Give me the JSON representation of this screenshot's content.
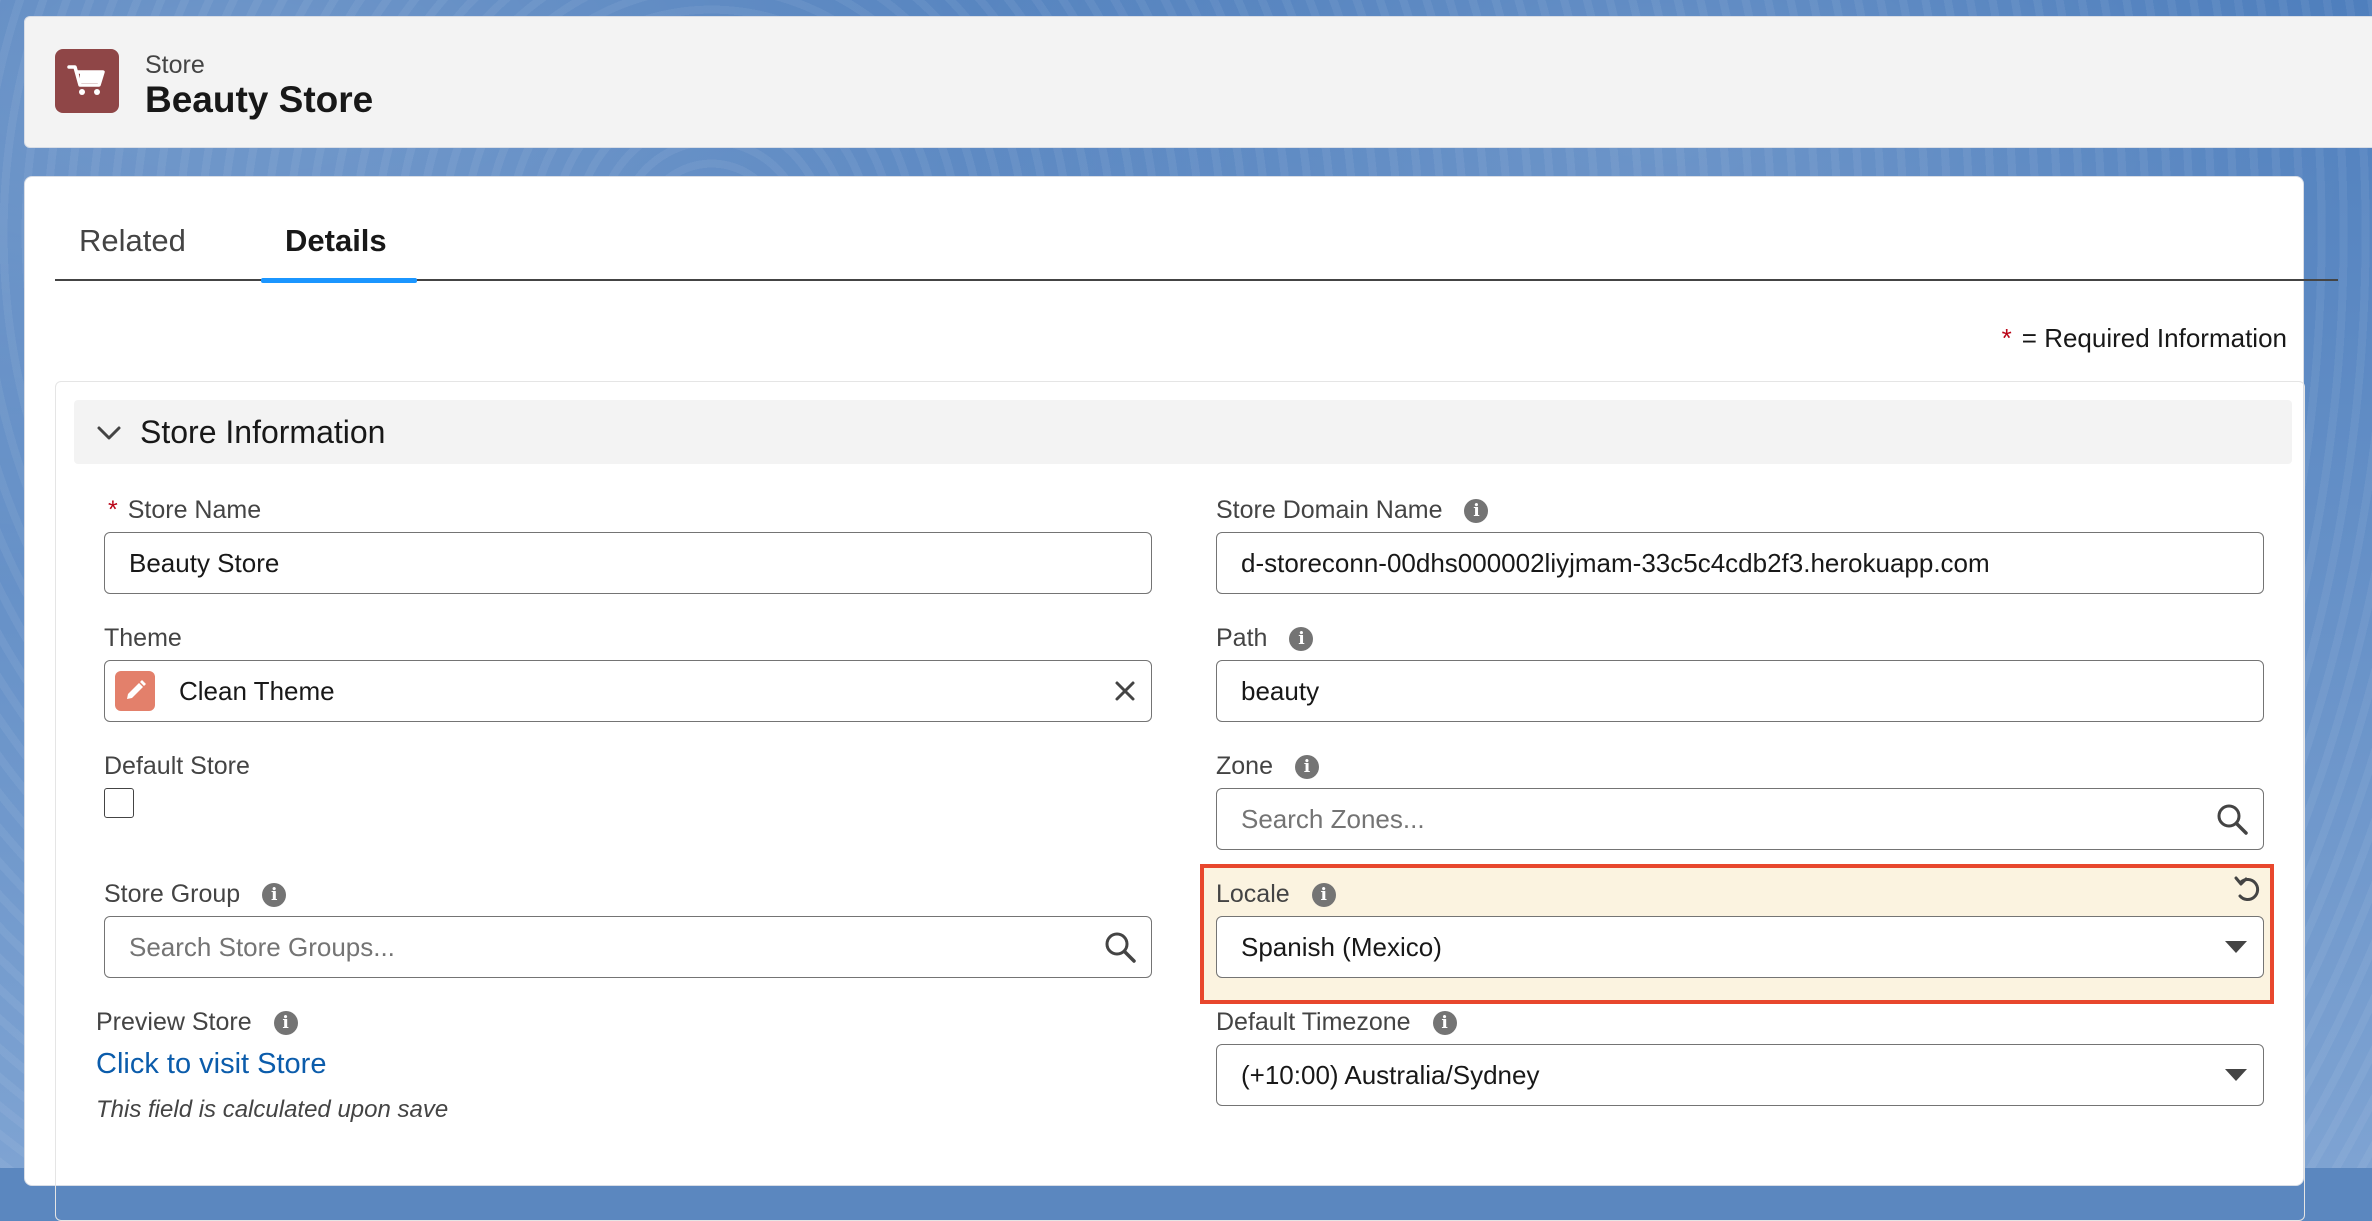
{
  "header": {
    "object_label": "Store",
    "record_title": "Beauty Store",
    "icon": "cart-icon"
  },
  "tabs": [
    {
      "label": "Related",
      "active": false
    },
    {
      "label": "Details",
      "active": true
    }
  ],
  "required_note": {
    "star": "*",
    "text": "= Required Information"
  },
  "section": {
    "title": "Store Information"
  },
  "fields": {
    "store_name": {
      "label": "Store Name",
      "required_mark": "*",
      "value": "Beauty Store"
    },
    "store_domain_name": {
      "label": "Store Domain Name",
      "value": "d-storeconn-00dhs000002liyjmam-33c5c4cdb2f3.herokuapp.com"
    },
    "theme": {
      "label": "Theme",
      "value": "Clean Theme"
    },
    "path": {
      "label": "Path",
      "value": "beauty"
    },
    "default_store": {
      "label": "Default Store",
      "checked": false
    },
    "zone": {
      "label": "Zone",
      "placeholder": "Search Zones..."
    },
    "store_group": {
      "label": "Store Group",
      "placeholder": "Search Store Groups..."
    },
    "locale": {
      "label": "Locale",
      "value": "Spanish (Mexico)"
    },
    "preview_store": {
      "label": "Preview Store",
      "link_text": "Click to visit Store",
      "note": "This field is calculated upon save"
    },
    "default_timezone": {
      "label": "Default Timezone",
      "value": "(+10:00) Australia/Sydney"
    }
  },
  "colors": {
    "brand_icon": "#8f4647",
    "theme_icon": "#e3806b",
    "active_tab": "#1b96ff",
    "highlight_border": "#e8472d",
    "highlight_fill": "#fbf3e0",
    "link": "#0b5cab",
    "required": "#ba0517"
  }
}
